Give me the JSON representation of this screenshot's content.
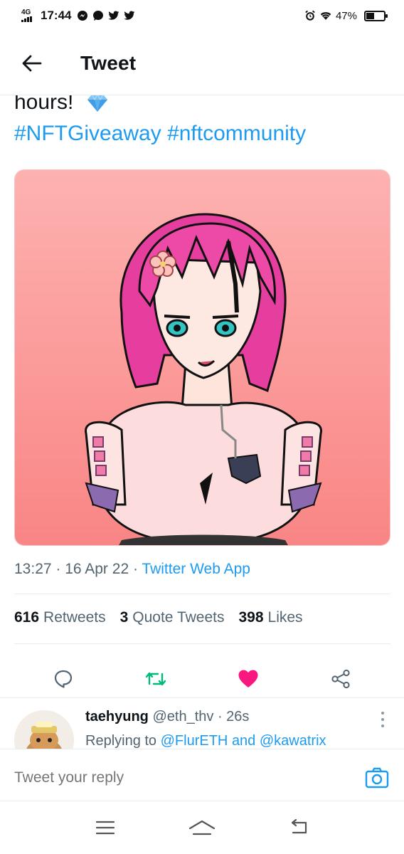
{
  "status_bar": {
    "network": "4G",
    "time": "17:44",
    "notification_icons": [
      "messenger-icon",
      "chat-icon",
      "twitter-icon",
      "twitter-icon"
    ],
    "battery_percent": "47%",
    "battery_level": 0.47
  },
  "header": {
    "title": "Tweet",
    "back_icon": "arrow-left-icon"
  },
  "tweet": {
    "text_line_1": "hours!",
    "emoji": "blue-diamond",
    "hashtag_1": "#NFTGiveaway",
    "hashtag_2": "#nftcommunity",
    "media_alt": "anime-girl-nft-artwork",
    "timestamp": "13:27 · 16 Apr 22",
    "meta_separator": " · ",
    "app": "Twitter Web App",
    "stats": {
      "retweets_count": "616",
      "retweets_label": "Retweets",
      "quotes_count": "3",
      "quotes_label": "Quote Tweets",
      "likes_count": "398",
      "likes_label": "Likes"
    },
    "liked": true,
    "colors": {
      "link": "#1d9bf0",
      "retweet": "#00ba7c",
      "like": "#f91880"
    }
  },
  "reply": {
    "name": "taehyung",
    "handle": "@eth_thv",
    "time": "· 26s",
    "replying_prefix": "Replying to",
    "mention_1": "@FlurETH",
    "and": "and",
    "mention_2": "@kawatrix"
  },
  "composer": {
    "placeholder": "Tweet your reply"
  },
  "navbar": {
    "items": [
      "menu-icon",
      "home-icon",
      "back-icon"
    ]
  }
}
